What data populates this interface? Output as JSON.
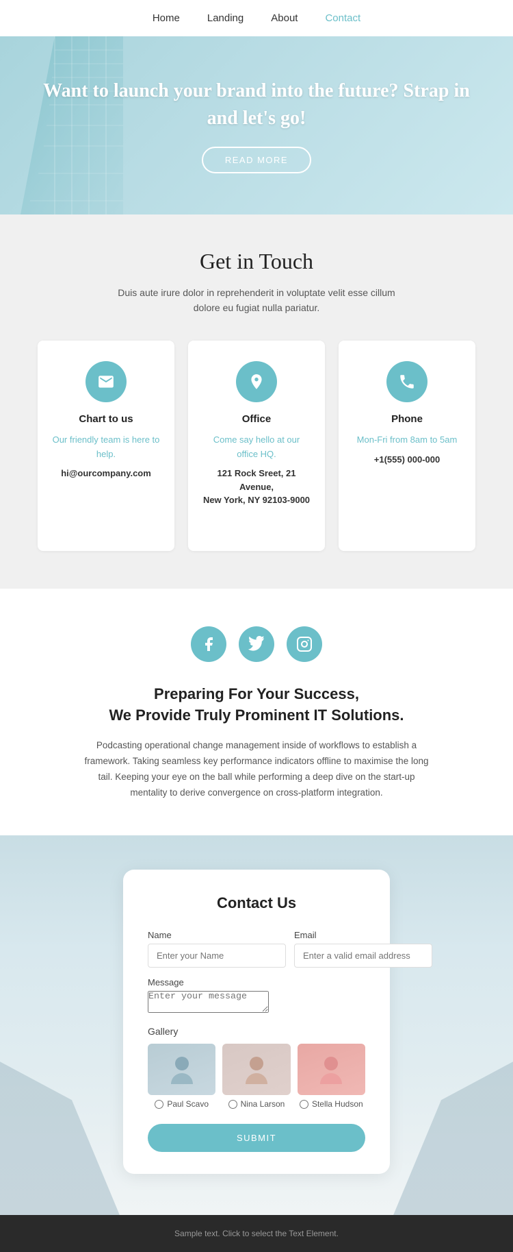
{
  "nav": {
    "items": [
      {
        "label": "Home",
        "active": false
      },
      {
        "label": "Landing",
        "active": false
      },
      {
        "label": "About",
        "active": false
      },
      {
        "label": "Contact",
        "active": true
      }
    ]
  },
  "hero": {
    "heading": "Want to launch your brand into the future? Strap in and let's go!",
    "cta_label": "READ MORE"
  },
  "get_in_touch": {
    "heading": "Get in Touch",
    "description": "Duis aute irure dolor in reprehenderit in voluptate velit esse cillum dolore eu fugiat nulla pariatur.",
    "cards": [
      {
        "icon": "email",
        "title": "Chart to us",
        "highlight": "Our friendly team is here to help.",
        "info": "hi@ourcompany.com"
      },
      {
        "icon": "location",
        "title": "Office",
        "highlight": "Come say hello at our office HQ.",
        "info": "121 Rock Sreet, 21 Avenue,\nNew York, NY 92103-9000"
      },
      {
        "icon": "phone",
        "title": "Phone",
        "highlight": "Mon-Fri from 8am to 5am",
        "info": "+1(555) 000-000"
      }
    ]
  },
  "social": {
    "icons": [
      {
        "name": "facebook",
        "symbol": "f"
      },
      {
        "name": "twitter",
        "symbol": "t"
      },
      {
        "name": "instagram",
        "symbol": "in"
      }
    ],
    "heading": "Preparing For Your Success,\nWe Provide Truly Prominent IT Solutions.",
    "body": "Podcasting operational change management inside of workflows to establish a framework. Taking seamless key performance indicators offline to maximise the long tail. Keeping your eye on the ball while performing a deep dive on the start-up mentality to derive convergence on cross-platform integration."
  },
  "contact_form": {
    "heading": "Contact Us",
    "name_label": "Name",
    "name_placeholder": "Enter your Name",
    "email_label": "Email",
    "email_placeholder": "Enter a valid email address",
    "message_label": "Message",
    "message_placeholder": "Enter your message",
    "gallery_label": "Gallery",
    "gallery_items": [
      {
        "name": "Paul Scavo",
        "bg": "person1"
      },
      {
        "name": "Nina Larson",
        "bg": "person2"
      },
      {
        "name": "Stella Hudson",
        "bg": "person3"
      }
    ],
    "submit_label": "SUBMIT"
  },
  "footer": {
    "text": "Sample text. Click to select the Text Element."
  },
  "colors": {
    "accent": "#6bbfc9",
    "dark": "#2a2a2a"
  }
}
